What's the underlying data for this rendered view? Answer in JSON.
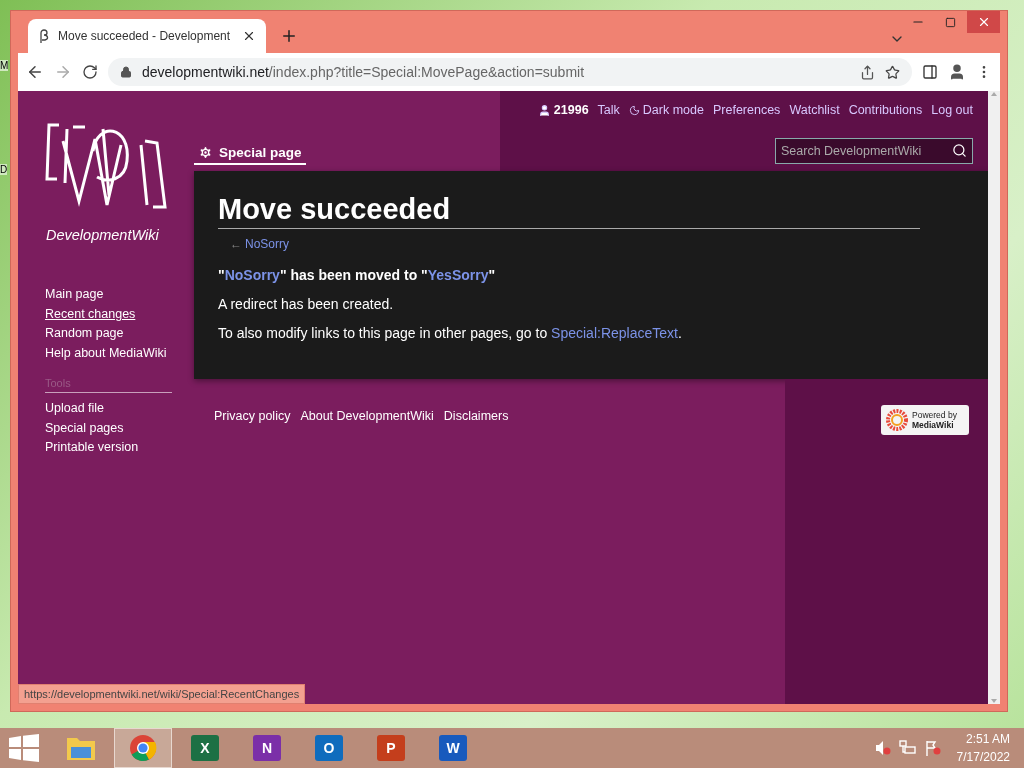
{
  "desktop": {
    "edge_labels": [
      "M",
      "D"
    ]
  },
  "browser": {
    "tab": {
      "title": "Move succeeded - Development"
    },
    "address": {
      "host": "developmentwiki.net",
      "path": "/index.php?title=Special:MovePage&action=submit"
    }
  },
  "wiki": {
    "user_links": [
      {
        "kind": "user",
        "label": "21996"
      },
      {
        "kind": "link",
        "label": "Talk"
      },
      {
        "kind": "moon",
        "label": "Dark mode"
      },
      {
        "kind": "link",
        "label": "Preferences"
      },
      {
        "kind": "link",
        "label": "Watchlist"
      },
      {
        "kind": "link",
        "label": "Contributions"
      },
      {
        "kind": "link",
        "label": "Log out"
      }
    ],
    "site_name": "DevelopmentWiki",
    "nav": [
      {
        "label": "Main page",
        "hovered": false
      },
      {
        "label": "Recent changes",
        "hovered": true
      },
      {
        "label": "Random page",
        "hovered": false
      },
      {
        "label": "Help about MediaWiki",
        "hovered": false
      }
    ],
    "tools_heading": "Tools",
    "tools": [
      {
        "label": "Upload file",
        "hovered": false
      },
      {
        "label": "Special pages",
        "hovered": false
      },
      {
        "label": "Printable version",
        "hovered": false
      }
    ],
    "page_tab": {
      "label": "Special page",
      "selected": true
    },
    "search": {
      "placeholder": "Search DevelopmentWiki"
    },
    "heading": "Move succeeded",
    "back": {
      "arrow": "←",
      "link": "NoSorry"
    },
    "messages": [
      {
        "kind": "bold",
        "parts": [
          {
            "text": "\""
          },
          {
            "text": "NoSorry",
            "link": true
          },
          {
            "text": "\" has been moved to \""
          },
          {
            "text": "YesSorry",
            "link": true
          },
          {
            "text": "\""
          }
        ]
      },
      {
        "kind": "plain",
        "parts": [
          {
            "text": "A redirect has been created."
          }
        ]
      },
      {
        "kind": "plain",
        "parts": [
          {
            "text": "To also modify links to this page in other pages, go to "
          },
          {
            "text": "Special:ReplaceText",
            "link": true
          },
          {
            "text": "."
          }
        ]
      }
    ],
    "footer_links": [
      "Privacy policy",
      "About DevelopmentWiki",
      "Disclaimers"
    ],
    "powered_by": {
      "line_1": "Powered by",
      "line_2": "MediaWiki"
    }
  },
  "status_url": "https://developmentwiki.net/wiki/Special:RecentChanges",
  "taskbar": {
    "apps": [
      {
        "kind": "explorer",
        "selected": false
      },
      {
        "kind": "chrome",
        "selected": true
      },
      {
        "kind": "office",
        "letter": "X",
        "color": "#1d7044",
        "selected": false
      },
      {
        "kind": "office",
        "letter": "N",
        "color": "#7b2fa8",
        "selected": false
      },
      {
        "kind": "office",
        "letter": "O",
        "color": "#0f6cbd",
        "selected": false
      },
      {
        "kind": "office",
        "letter": "P",
        "color": "#c43e1c",
        "selected": false
      },
      {
        "kind": "office",
        "letter": "W",
        "color": "#185abd",
        "selected": false
      }
    ],
    "time": "2:51 AM",
    "date": "7/17/2022"
  }
}
